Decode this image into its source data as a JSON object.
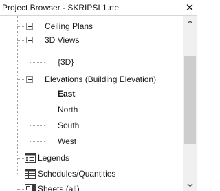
{
  "window": {
    "title": "Project Browser - SKRIPSI 1.rte"
  },
  "tree": {
    "ceiling_plans": "Ceiling Plans",
    "views_3d": "3D Views",
    "view_3d_default": "{3D}",
    "elevations": "Elevations (Building Elevation)",
    "elev_east": "East",
    "elev_north": "North",
    "elev_south": "South",
    "elev_west": "West",
    "legends": "Legends",
    "schedules": "Schedules/Quantities",
    "sheets": "Sheets (all)"
  },
  "icons": {
    "close": "close-icon",
    "expand": "plus-icon",
    "collapse": "minus-icon",
    "legends": "legend-icon",
    "schedules": "schedule-table-icon",
    "sheets": "sheet-icon",
    "scroll_up": "chevron-up-icon",
    "scroll_down": "chevron-down-icon"
  },
  "colors": {
    "tree_line": "#a0a0a0",
    "scrollbar_thumb": "#cdcdcd"
  }
}
